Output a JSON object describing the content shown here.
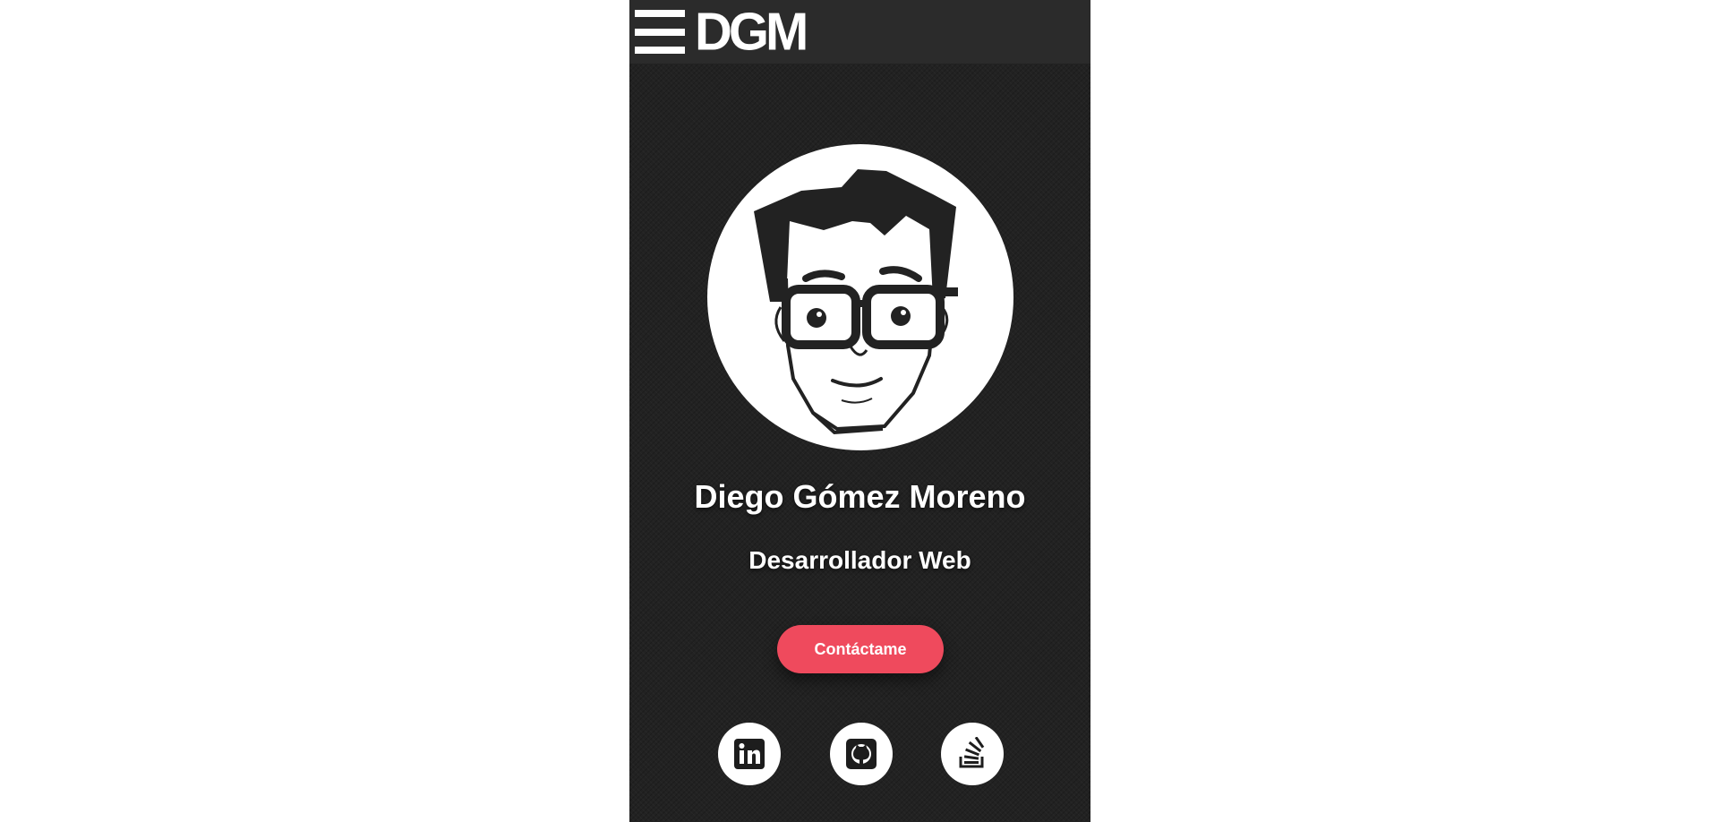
{
  "header": {
    "logo_text": "DGM",
    "menu_icon": "hamburger-menu-icon"
  },
  "profile": {
    "avatar_icon": "cartoon-avatar-with-glasses",
    "name": "Diego Gómez Moreno",
    "role": "Desarrollador Web"
  },
  "cta": {
    "label": "Contáctame",
    "color": "#ef4a5d"
  },
  "social_links": [
    {
      "icon": "linkedin-icon"
    },
    {
      "icon": "github-icon"
    },
    {
      "icon": "stackoverflow-icon"
    }
  ],
  "colors": {
    "page_background": "#ffffff",
    "panel_background": "#222222",
    "topbar_background": "#2b2b2b",
    "text": "#ffffff"
  }
}
